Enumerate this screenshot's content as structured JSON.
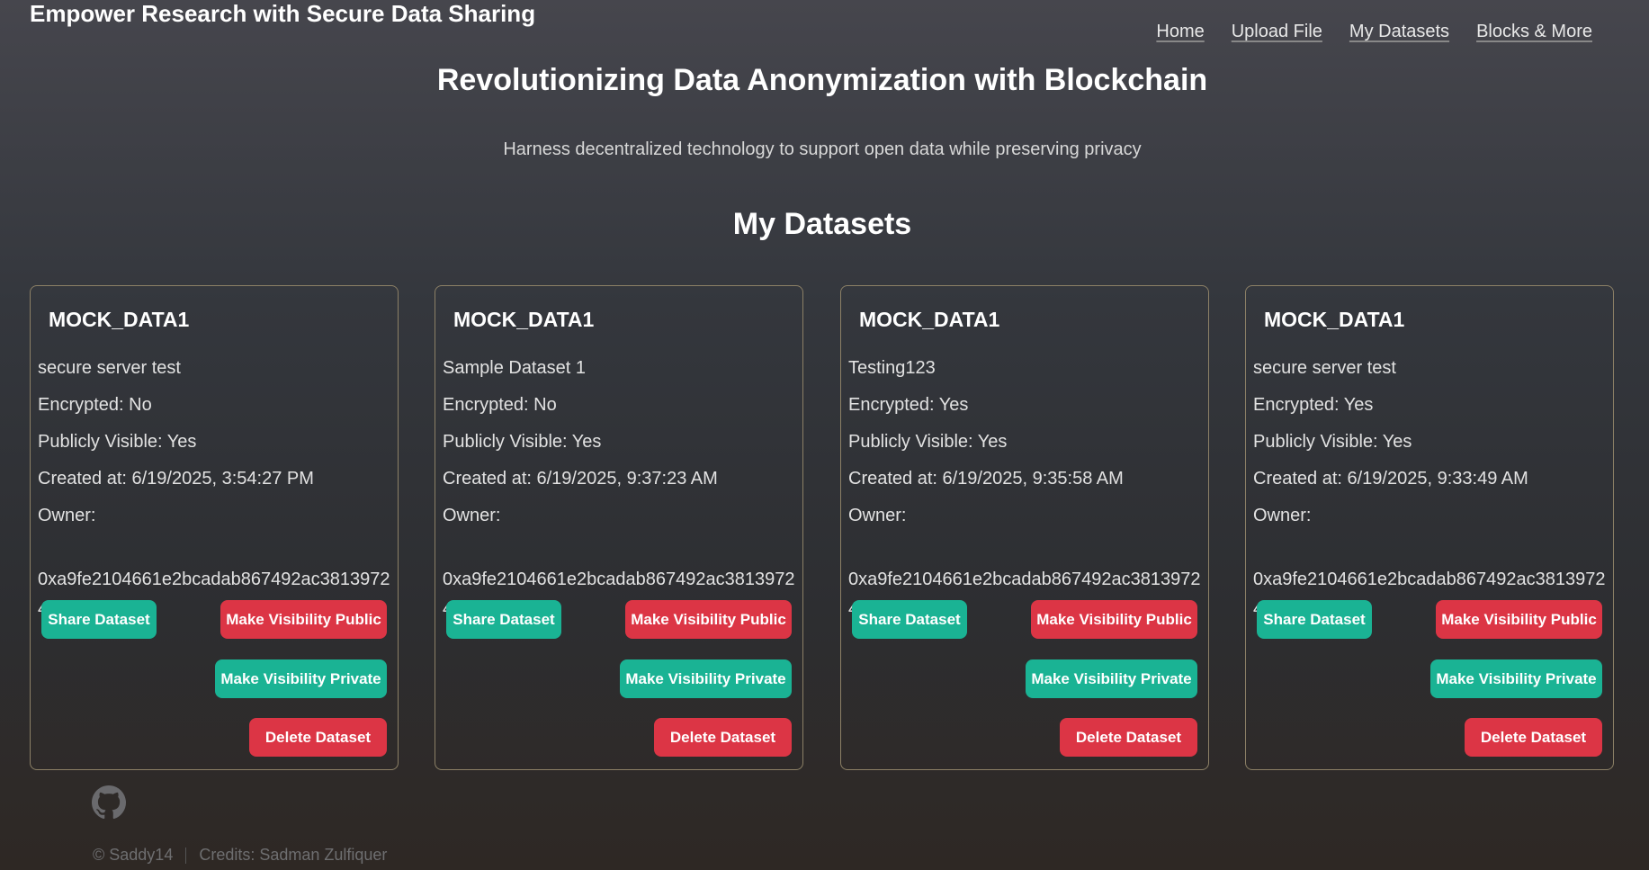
{
  "header": {
    "site_title": "Empower Research with Secure Data Sharing",
    "nav": [
      "Home",
      "Upload File",
      "My Datasets",
      "Blocks & More"
    ]
  },
  "hero": {
    "title": "Revolutionizing Data Anonymization with Blockchain",
    "subtitle": "Harness decentralized technology to support open data while preserving privacy"
  },
  "section": {
    "title": "My Datasets"
  },
  "buttons": {
    "share": "Share Dataset",
    "public": "Make Visibility Public",
    "private": "Make Visibility Private",
    "delete": "Delete Dataset"
  },
  "datasets": [
    {
      "name": "MOCK_DATA1",
      "description": "secure server test",
      "encrypted": "Encrypted: No",
      "visible": "Publicly Visible: Yes",
      "created": "Created at: 6/19/2025, 3:54:27 PM",
      "owner_label": "Owner:",
      "owner": "0xa9fe2104661e2bcadab867492ac38139724a153c"
    },
    {
      "name": "MOCK_DATA1",
      "description": "Sample Dataset 1",
      "encrypted": "Encrypted: No",
      "visible": "Publicly Visible: Yes",
      "created": "Created at: 6/19/2025, 9:37:23 AM",
      "owner_label": "Owner:",
      "owner": "0xa9fe2104661e2bcadab867492ac38139724a153c"
    },
    {
      "name": "MOCK_DATA1",
      "description": "Testing123",
      "encrypted": "Encrypted: Yes",
      "visible": "Publicly Visible: Yes",
      "created": "Created at: 6/19/2025, 9:35:58 AM",
      "owner_label": "Owner:",
      "owner": "0xa9fe2104661e2bcadab867492ac38139724a153c"
    },
    {
      "name": "MOCK_DATA1",
      "description": "secure server test",
      "encrypted": "Encrypted: Yes",
      "visible": "Publicly Visible: Yes",
      "created": "Created at: 6/19/2025, 9:33:49 AM",
      "owner_label": "Owner:",
      "owner": "0xa9fe2104661e2bcadab867492ac38139724a153c"
    }
  ],
  "footer": {
    "copyright": "© Saddy14",
    "credits": "Credits: Sadman Zulfiquer",
    "icon": "github-icon"
  },
  "colors": {
    "teal_button": "#1ab394",
    "red_button": "#dc3545",
    "card_border": "#8c8066"
  }
}
